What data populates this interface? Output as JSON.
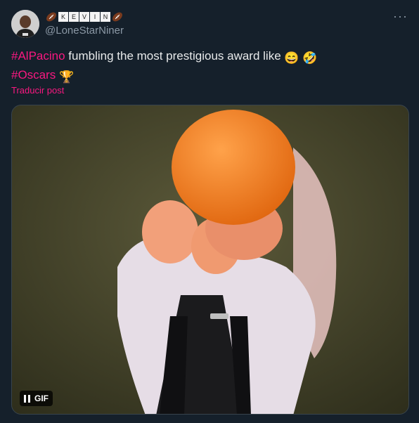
{
  "tweet": {
    "display_name_letters": [
      "K",
      "E",
      "V",
      "I",
      "N"
    ],
    "handle": "@LoneStarNiner",
    "more_label": "···",
    "text": {
      "hashtag1": "#AlPacino",
      "body": " fumbling the most prestigious award like ",
      "emoji1": "😄",
      "emoji2": "🤣",
      "hashtag2": "#Oscars",
      "emoji3": "🏆"
    },
    "translate_label": "Traducir post",
    "media": {
      "type": "gif",
      "gif_label": "GIF"
    }
  },
  "colors": {
    "background": "#15202b",
    "accent": "#f91880",
    "secondary_text": "#8b98a5",
    "primary_text": "#e7e9ea"
  },
  "icons": [
    "american-football-icon",
    "more-options-icon",
    "pause-icon"
  ]
}
